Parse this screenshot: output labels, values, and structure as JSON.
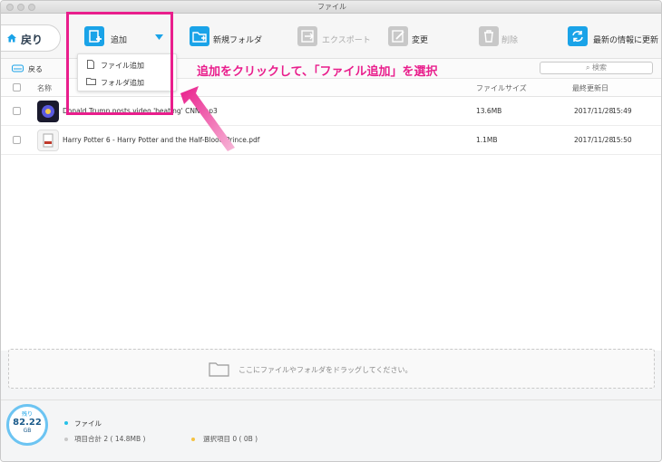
{
  "window": {
    "title": "ファイル"
  },
  "toolbar": {
    "back_label": "戻り",
    "add_label": "追加",
    "new_folder_label": "新規フォルダ",
    "export_label": "エクスポート",
    "rename_label": "変更",
    "delete_label": "削除",
    "refresh_label": "最新の情報に更新"
  },
  "add_menu": {
    "items": [
      {
        "label": "ファイル追加"
      },
      {
        "label": "フォルダ追加"
      }
    ]
  },
  "subbar": {
    "back_label": "戻る",
    "search_placeholder": "検索"
  },
  "table": {
    "columns": {
      "name": "名称",
      "size": "ファイルサイズ",
      "modified": "最終更新日"
    },
    "rows": [
      {
        "name": "Donald Trump posts video 'beating' CNN.mp3",
        "size": "13.6MB",
        "date": "2017/11/28",
        "time": "15:49"
      },
      {
        "name": "Harry Potter 6 - Harry Potter and the Half-Blood Prince.pdf",
        "size": "1.1MB",
        "date": "2017/11/28",
        "time": "15:50"
      }
    ]
  },
  "dropzone": {
    "text": "ここにファイルやフォルダをドラッグしてください。"
  },
  "storage": {
    "remaining_label": "残り",
    "value": "82.22",
    "unit": "GB"
  },
  "footer": {
    "category": "ファイル",
    "total": "項目合計 2 ( 14.8MB )",
    "selected": "選択項目 0 ( 0B )"
  },
  "annotation": {
    "text": "追加をクリックして、「ファイル追加」を選択"
  },
  "colors": {
    "accent": "#1aa3e8",
    "annotation": "#e91e8c",
    "category_dot": "#25c0e8",
    "selected_dot": "#f5c242"
  }
}
